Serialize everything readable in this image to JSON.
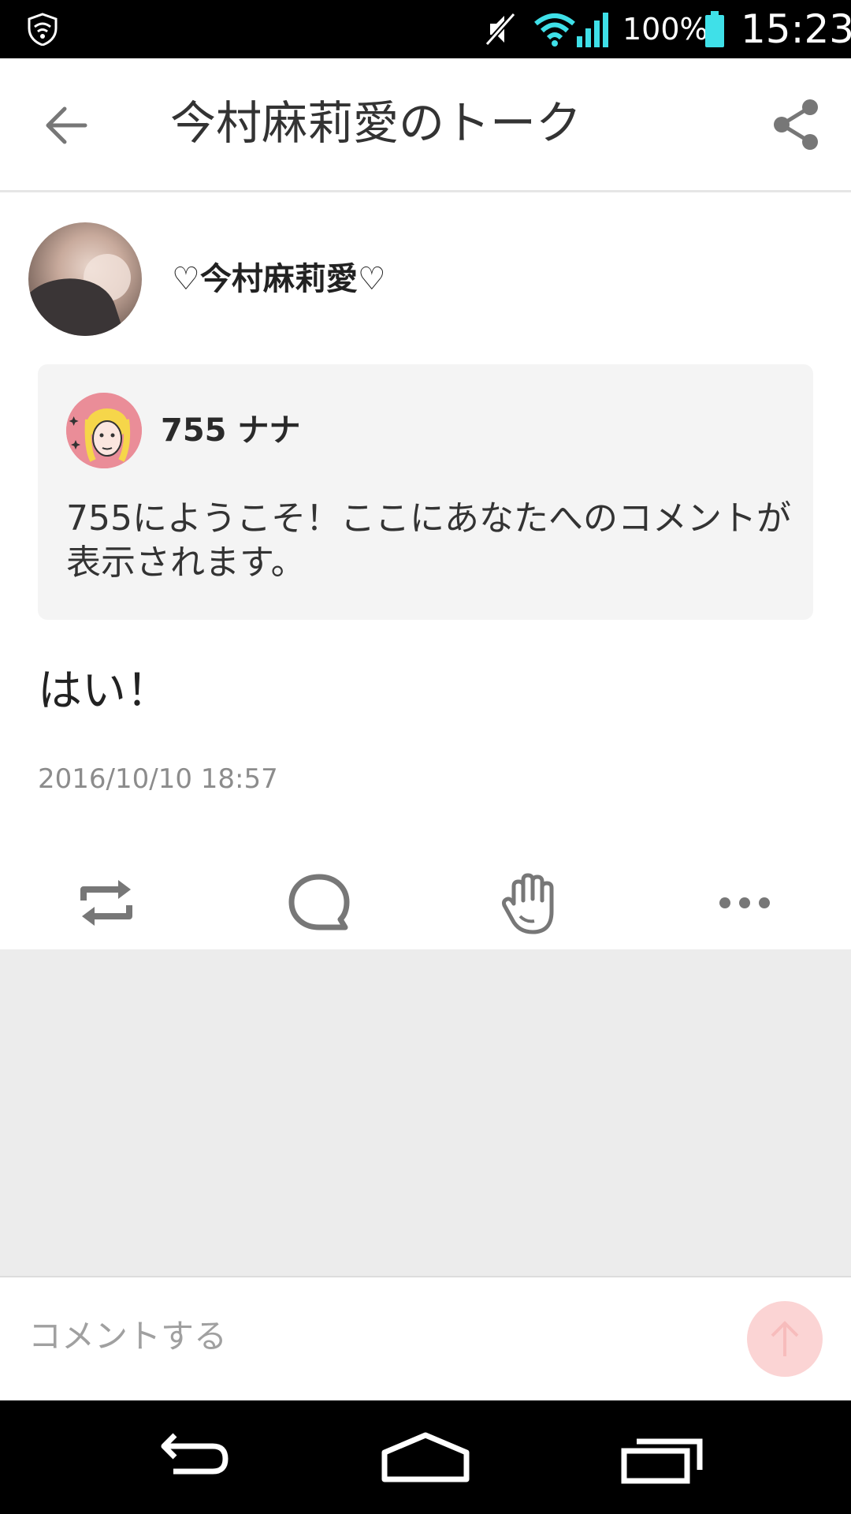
{
  "status_bar": {
    "battery_percent": "100%",
    "time": "15:23"
  },
  "header": {
    "title": "今村麻莉愛のトーク"
  },
  "post": {
    "author": "♡今村麻莉愛♡",
    "quoted": {
      "author": "755 ナナ",
      "text": "755にようこそ！ここにあなたへのコメントが表示されます。"
    },
    "body": "はい！",
    "timestamp": "2016/10/10 18:57"
  },
  "actions": {
    "icons": [
      "repost-icon",
      "comment-icon",
      "clap-icon",
      "more-icon"
    ]
  },
  "comment": {
    "placeholder": "コメントする"
  },
  "colors": {
    "accent": "#fbd4d4",
    "background_gray": "#ececec",
    "card_bg": "#f4f4f4",
    "icon_gray": "#777777"
  }
}
